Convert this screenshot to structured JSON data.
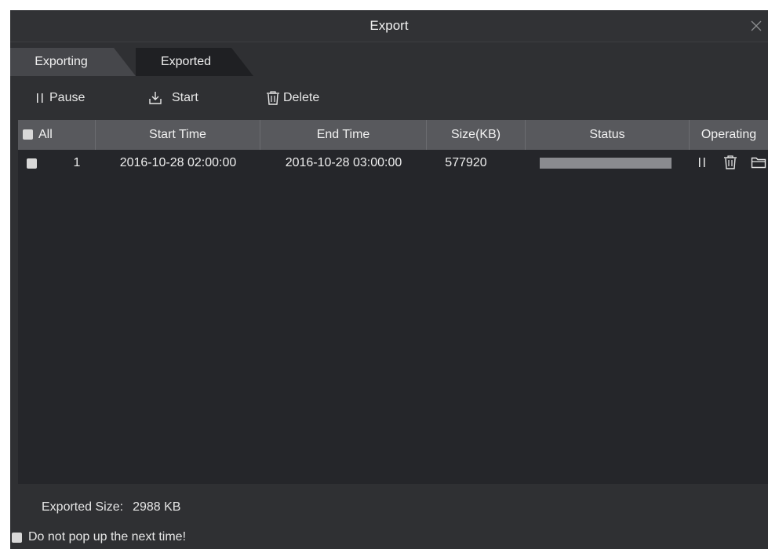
{
  "window": {
    "title": "Export",
    "close_icon": "close-icon"
  },
  "tabs": [
    {
      "label": "Exporting",
      "active": false
    },
    {
      "label": "Exported",
      "active": true
    }
  ],
  "toolbar": {
    "pause_label": "Pause",
    "start_label": "Start",
    "delete_label": "Delete"
  },
  "table": {
    "headers": {
      "select": "All",
      "start_time": "Start Time",
      "end_time": "End Time",
      "size": "Size(KB)",
      "status": "Status",
      "operating": "Operating"
    },
    "rows": [
      {
        "index": "1",
        "start_time": "2016-10-28 02:00:00",
        "end_time": "2016-10-28 03:00:00",
        "size": "577920",
        "progress": 1.0,
        "operations": [
          "pause-icon",
          "trash-icon",
          "folder-icon"
        ]
      }
    ]
  },
  "footer": {
    "exported_size_label": "Exported Size:",
    "exported_size_value": "2988 KB",
    "no_popup_label": "Do not pop up the next time!"
  },
  "colors": {
    "dialog_bg": "#2f3033",
    "table_bg": "#25262a",
    "header_bg": "#58595d",
    "active_tab": "#1f2023",
    "inactive_tab": "#46474b",
    "progress_fill": "#8a8b8f"
  }
}
